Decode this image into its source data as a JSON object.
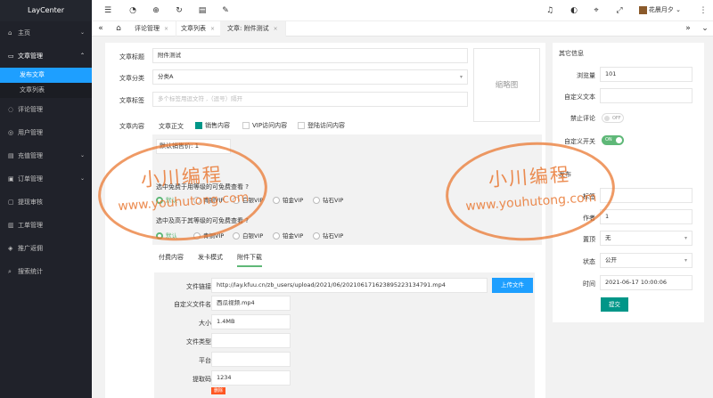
{
  "app": {
    "logo": "LayCenter"
  },
  "sidebar": {
    "items": [
      {
        "label": "主页",
        "icon": "home-icon",
        "arrow": "⌄"
      },
      {
        "label": "文章管理",
        "icon": "article-icon",
        "arrow": "⌃"
      },
      {
        "label": "评论管理",
        "icon": "comment-icon",
        "arrow": ""
      },
      {
        "label": "用户管理",
        "icon": "user-icon",
        "arrow": ""
      },
      {
        "label": "充值管理",
        "icon": "recharge-icon",
        "arrow": "⌄"
      },
      {
        "label": "订单管理",
        "icon": "order-icon",
        "arrow": "⌄"
      },
      {
        "label": "提现审核",
        "icon": "withdraw-icon",
        "arrow": ""
      },
      {
        "label": "工单管理",
        "icon": "ticket-icon",
        "arrow": ""
      },
      {
        "label": "推广返佣",
        "icon": "promote-icon",
        "arrow": ""
      },
      {
        "label": "搜索统计",
        "icon": "search-icon",
        "arrow": ""
      }
    ],
    "subitems": [
      {
        "label": "发布文章"
      },
      {
        "label": "文章列表"
      }
    ]
  },
  "topbar": {
    "user": "花晨月夕"
  },
  "tabs": [
    {
      "label": "评论管理"
    },
    {
      "label": "文章列表"
    },
    {
      "label": "文章: 附件测试"
    }
  ],
  "form": {
    "title_label": "文章标题",
    "title_value": "附件测试",
    "category_label": "文章分类",
    "category_value": "分类A",
    "tags_label": "文章标签",
    "tags_placeholder": "多个标签用逗文符 ,（逗号）隔开",
    "thumb_label": "缩略图",
    "content_label": "文章内容",
    "content_opts": [
      "文章正文",
      "销售内容",
      "VIP访问内容",
      "登陆访问内容"
    ],
    "price_label": "默认销售价:",
    "price_value": "1",
    "q1": "选中免费于用等级的可免费查看 ?",
    "q2": "选中及高于其等级的可免费查看 ?",
    "levels": [
      "默认",
      "青铜VIP",
      "白银VIP",
      "铂金VIP",
      "钻石VIP"
    ],
    "subtabs": [
      "付费内容",
      "发卡模式",
      "附件下载"
    ],
    "file_link_label": "文件链接",
    "file_link": "http://lay.kfuu.cn/zb_users/upload/2021/06/202106171623895223134791.mp4",
    "upload_label": "上传文件",
    "fname_label": "自定义文件名",
    "fname": "西瓜视频.mp4",
    "size_label": "大小",
    "size": "1.4MB",
    "ftype_label": "文件类型",
    "platform_label": "平台",
    "code_label": "提取码",
    "code": "1234",
    "delete_label": "删除"
  },
  "right": {
    "title": "其它信息",
    "views_label": "浏览量",
    "views": "101",
    "custom_text_label": "自定义文本",
    "disable_comment_label": "禁止评论",
    "disable_comment_state": "OFF",
    "custom_switch_label": "自定义开关",
    "custom_switch_state": "ON",
    "publish_label": "发布",
    "tag_label": "标签",
    "author_label": "作者",
    "author": "1",
    "top_label": "置顶",
    "top": "无",
    "status_label": "状态",
    "status": "公开",
    "time_label": "时间",
    "time": "2021-06-17 10:00:06",
    "submit_label": "提交"
  },
  "watermark": {
    "t1": "小川编程",
    "t2": "www.youhutong.com"
  },
  "colors": {
    "sidebar": "#20222a",
    "accent": "#1e9fff",
    "green": "#5fb878",
    "teal": "#009688"
  }
}
